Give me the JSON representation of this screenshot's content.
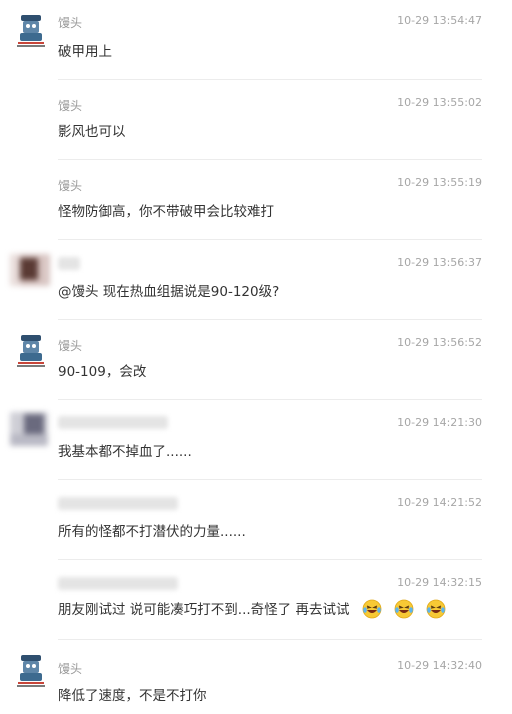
{
  "comments": [
    {
      "name": "馒头",
      "time": "10-29 13:54:47",
      "text": "破甲用上"
    },
    {
      "name": "馒头",
      "time": "10-29 13:55:02",
      "text": "影风也可以"
    },
    {
      "name": "馒头",
      "time": "10-29 13:55:19",
      "text": "怪物防御高，你不带破甲会比较难打"
    },
    {
      "name": "",
      "time": "10-29 13:56:37",
      "text": "@馒头 现在热血组据说是90-120级?"
    },
    {
      "name": "馒头",
      "time": "10-29 13:56:52",
      "text": "90-109，会改"
    },
    {
      "name": "",
      "time": "10-29 14:21:30",
      "text": "我基本都不掉血了......"
    },
    {
      "name": "",
      "time": "10-29 14:21:52",
      "text": "所有的怪都不打潜伏的力量......"
    },
    {
      "name": "",
      "time": "10-29 14:32:15",
      "text": "朋友刚试过 说可能凑巧打不到...奇怪了 再去试试"
    },
    {
      "name": "馒头",
      "time": "10-29 14:32:40",
      "text": "降低了速度，不是不打你"
    }
  ],
  "emoji": {
    "name": "laughing-tears-emoji",
    "count": 3
  },
  "colors": {
    "text": "#333333",
    "meta": "#a6a6a6",
    "divider": "#ececec"
  }
}
